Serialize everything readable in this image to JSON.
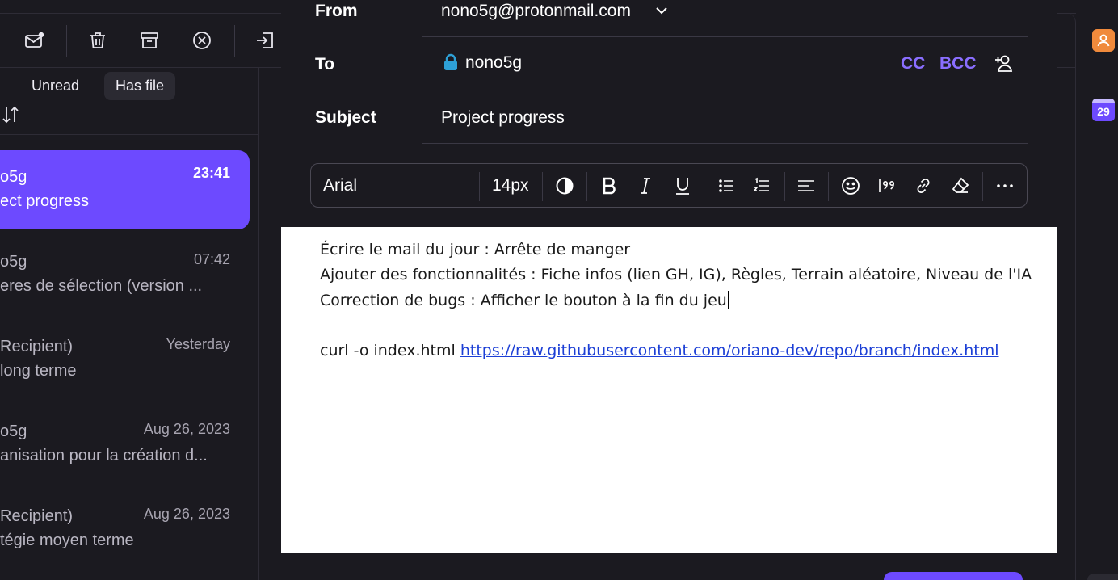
{
  "list": {
    "filters": {
      "unread": "Unread",
      "has_file": "Has file"
    },
    "items": [
      {
        "from": "o5g",
        "subject": "ect progress",
        "time": "23:41"
      },
      {
        "from": "o5g",
        "subject": "eres de sélection (version ...",
        "time": "07:42"
      },
      {
        "from": "Recipient)",
        "subject": " long terme",
        "time": "Yesterday"
      },
      {
        "from": "o5g",
        "subject": "anisation pour la création d...",
        "time": "Aug 26, 2023"
      },
      {
        "from": "Recipient)",
        "subject": "tégie moyen terme",
        "time": "Aug 26, 2023"
      }
    ]
  },
  "sidebar": {
    "calendar_day": "29"
  },
  "composer": {
    "from_label": "From",
    "from_value": "nono5g@protonmail.com",
    "to_label": "To",
    "to_value": "nono5g",
    "cc_label": "CC",
    "bcc_label": "BCC",
    "subject_label": "Subject",
    "subject_value": "Project progress",
    "toolbar": {
      "font": "Arial",
      "size": "14px"
    },
    "body": {
      "line1": "Écrire le mail du jour : Arrête de manger",
      "line2": "Ajouter des fonctionnalités : Fiche infos (lien GH, IG), Règles, Terrain aléatoire, Niveau de l'IA",
      "line3": "Correction de bugs : Afficher le bouton à la fin du jeu",
      "line5_prefix": "curl -o index.html ",
      "line5_link": "https://raw.githubusercontent.com/oriano-dev/repo/branch/index.html"
    }
  },
  "colors": {
    "accent": "#6d4aff",
    "background": "#1b1a20",
    "link": "#1c3fd6",
    "lock": "#2ea0d6"
  }
}
